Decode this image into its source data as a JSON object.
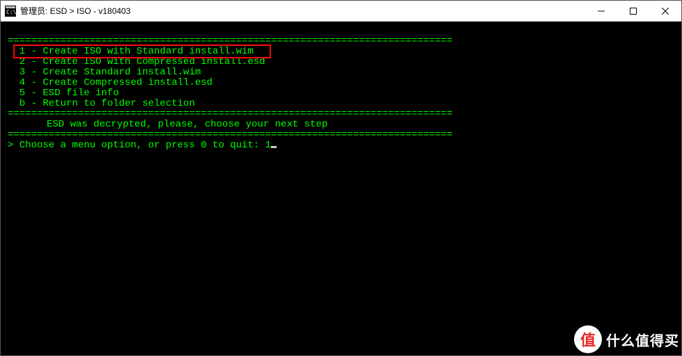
{
  "titlebar": {
    "text": "管理员:  ESD > ISO - v180403"
  },
  "separator": "============================================================================",
  "menu": {
    "items": [
      "  1 - Create ISO with Standard install.wim",
      "  2 - Create ISO with Compressed install.esd",
      "  3 - Create Standard install.wim",
      "  4 - Create Compressed install.esd",
      "  5 - ESD file info",
      "  b - Return to folder selection"
    ]
  },
  "status": "ESD was decrypted, please, choose your next step",
  "prompt_prefix": "> Choose a menu option, or press 0 to quit: ",
  "prompt_input": "1",
  "watermark": {
    "badge": "值",
    "text": "什么值得买"
  }
}
